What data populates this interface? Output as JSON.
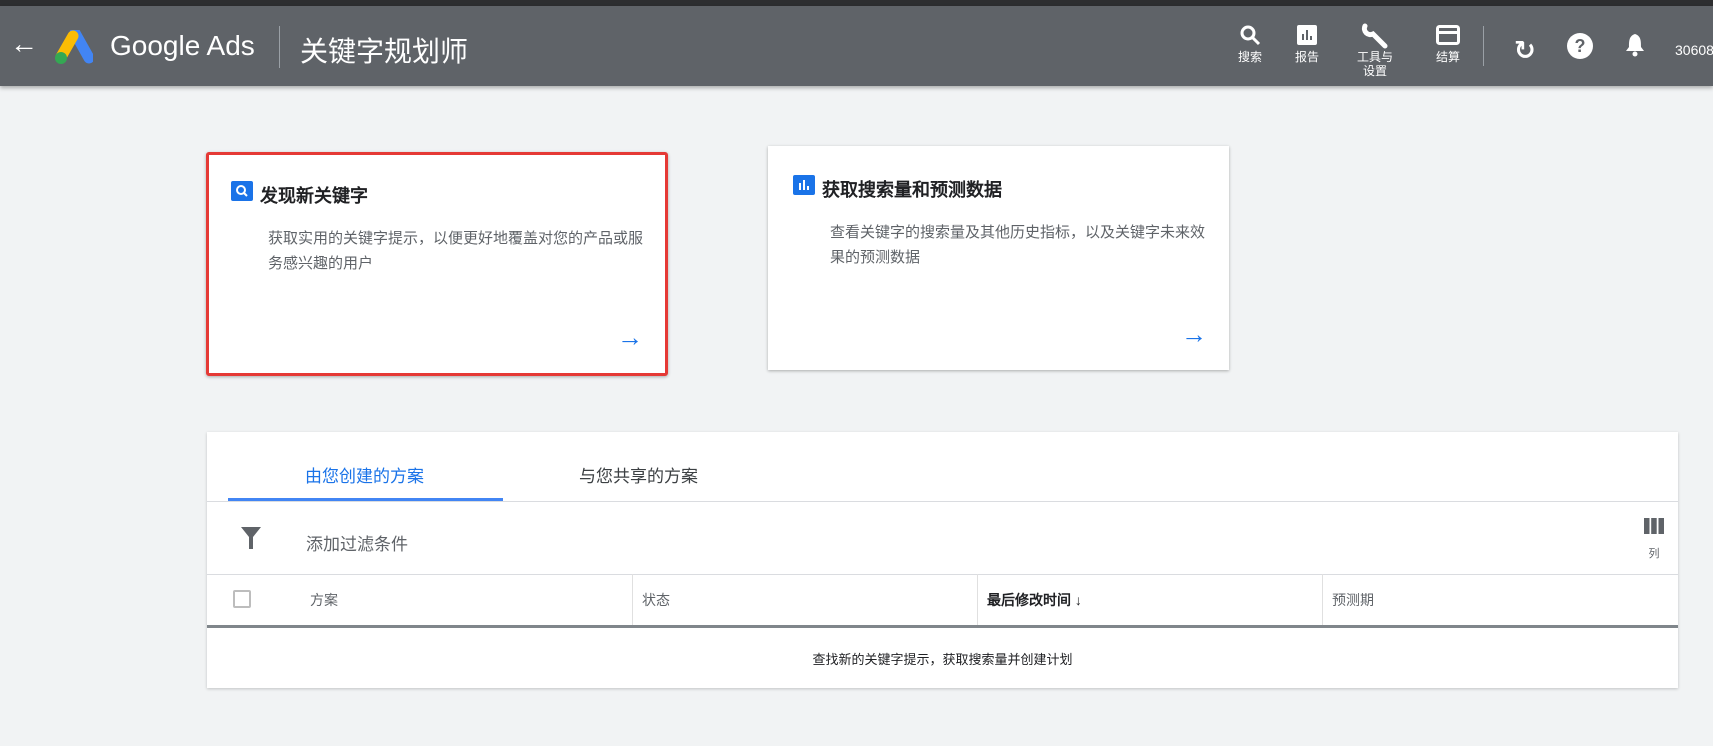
{
  "header": {
    "brand": "Google Ads",
    "page_title": "关键字规划师",
    "nav": [
      {
        "label": "搜索",
        "icon": "search-icon"
      },
      {
        "label": "报告",
        "icon": "reports-icon"
      },
      {
        "label": "工具与设置",
        "icon": "wrench-icon"
      },
      {
        "label": "结算",
        "icon": "billing-icon"
      }
    ],
    "account": "30608"
  },
  "cards": [
    {
      "title": "发现新关键字",
      "description": "获取实用的关键字提示，以便更好地覆盖对您的产品或服务感兴趣的用户",
      "icon": "search-icon"
    },
    {
      "title": "获取搜索量和预测数据",
      "description": "查看关键字的搜索量及其他历史指标，以及关键字未来效果的预测数据",
      "icon": "bar-chart-icon"
    }
  ],
  "plans": {
    "tabs": [
      "由您创建的方案",
      "与您共享的方案"
    ],
    "active_tab": 0,
    "filter_label": "添加过滤条件",
    "columns_label": "列",
    "table_headers": [
      "方案",
      "状态",
      "最后修改时间",
      "预测期"
    ],
    "sorted_column": "最后修改时间",
    "sort_direction": "descending",
    "empty_message": "查找新的关键字提示，获取搜索量并创建计划"
  },
  "colors": {
    "header": "#5f6368",
    "accent": "#1a73e8",
    "highlight": "#e53935"
  }
}
